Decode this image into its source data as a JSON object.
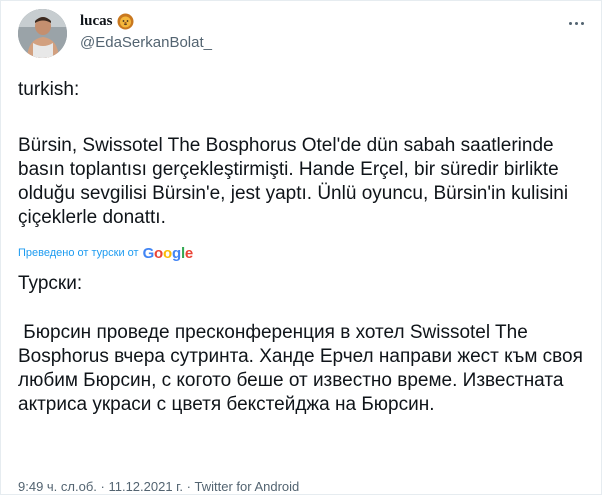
{
  "author": {
    "display_name": "lucas",
    "emoji": "lion-face-icon",
    "handle": "@EdaSerkanBolat_"
  },
  "tweet": {
    "source_label": "turkish:",
    "source_text": "Bürsin, Swissotel The Bosphorus Otel'de dün sabah saatlerinde basın toplantısı gerçekleştirmişti. Hande Erçel, bir süredir birlikte olduğu sevgilisi Bürsin'e, jest yaptı. Ünlü oyuncu, Bürsin'in kulisini çiçeklerle donattı.",
    "translated_by": "Преведено от турски от",
    "translated_by_logo": "Google",
    "translation_label": "Турски:",
    "translation_text": " Бюрсин проведе пресконференция в хотел Swissotel The Bosphorus вчера сутринта. Ханде Ерчел направи жест към своя любим Бюрсин, с когото беше от известно време. Известната актриса украси с цветя бекстейджа на Бюрсин."
  },
  "meta": {
    "time": "9:49 ч. сл.об.",
    "separator1": " · ",
    "date": "11.12.2021 г.",
    "separator2": " · ",
    "client": "Twitter for Android"
  },
  "colors": {
    "link": "#1d9bf0",
    "secondary_text": "#536471",
    "primary_text": "#0f1419",
    "google_blue": "#4285F4",
    "google_red": "#EA4335",
    "google_yellow": "#FBBC05",
    "google_green": "#34A853"
  }
}
